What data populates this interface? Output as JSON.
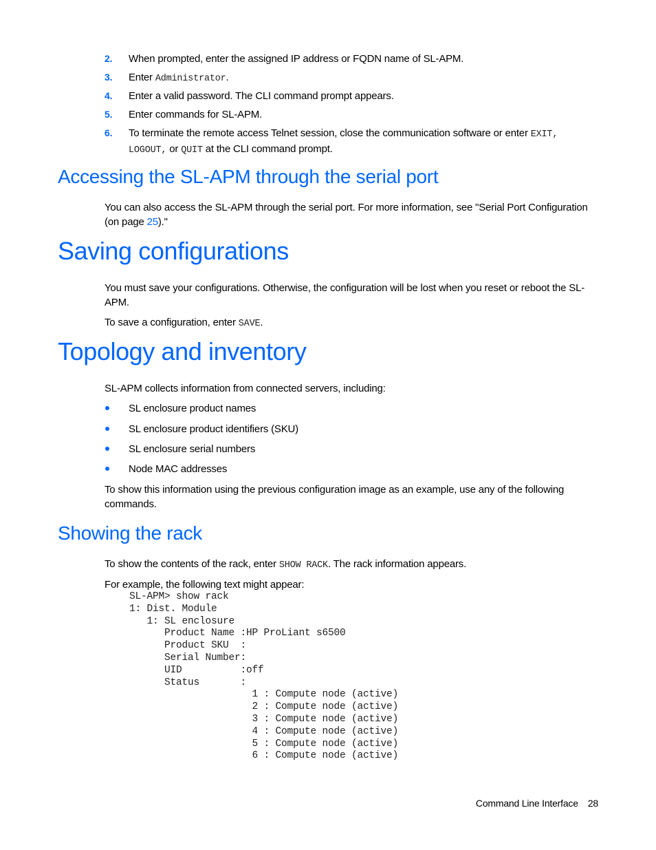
{
  "steps": [
    {
      "num": "2.",
      "text": "When prompted, enter the assigned IP address or FQDN name of SL-APM."
    },
    {
      "num": "3.",
      "pre": "Enter ",
      "code": "Administrator",
      "post": "."
    },
    {
      "num": "4.",
      "text": "Enter a valid password. The CLI command prompt appears."
    },
    {
      "num": "5.",
      "text": "Enter commands for SL-APM."
    },
    {
      "num": "6.",
      "line1_pre": "To terminate the remote access Telnet session, close the communication software or enter ",
      "code1": "EXIT,",
      "code2": "LOGOUT,",
      "mid": " or ",
      "code3": "QUIT",
      "post": " at the CLI command prompt."
    }
  ],
  "serial": {
    "heading": "Accessing the SL-APM through the serial port",
    "text_pre": "You can also access the SL-APM through the serial port. For more information, see \"Serial Port Configuration (on page ",
    "link": "25",
    "text_post": ").\""
  },
  "saving": {
    "heading": "Saving configurations",
    "para1": "You must save your configurations. Otherwise, the configuration will be lost when you reset or reboot the SL-APM.",
    "para2_pre": "To save a configuration, enter ",
    "para2_code": "SAVE",
    "para2_post": "."
  },
  "topology": {
    "heading": "Topology and inventory",
    "intro": "SL-APM collects information from connected servers, including:",
    "bullets": [
      "SL enclosure product names",
      "SL enclosure product identifiers (SKU)",
      "SL enclosure serial numbers",
      "Node MAC addresses"
    ],
    "outro": "To show this information using the previous configuration image as an example, use any of the following commands."
  },
  "rack": {
    "heading": "Showing the rack",
    "para1_pre": "To show the contents of the rack, enter ",
    "para1_code": "SHOW RACK",
    "para1_post": ". The rack information appears.",
    "para2": "For example, the following text might appear:",
    "code": "SL-APM> show rack\n1: Dist. Module\n   1: SL enclosure\n      Product Name :HP ProLiant s6500\n      Product SKU  :\n      Serial Number:\n      UID          :off\n      Status       :\n                     1 : Compute node (active)\n                     2 : Compute node (active)\n                     3 : Compute node (active)\n                     4 : Compute node (active)\n                     5 : Compute node (active)\n                     6 : Compute node (active)"
  },
  "footer": {
    "section": "Command Line Interface",
    "page": "28"
  }
}
